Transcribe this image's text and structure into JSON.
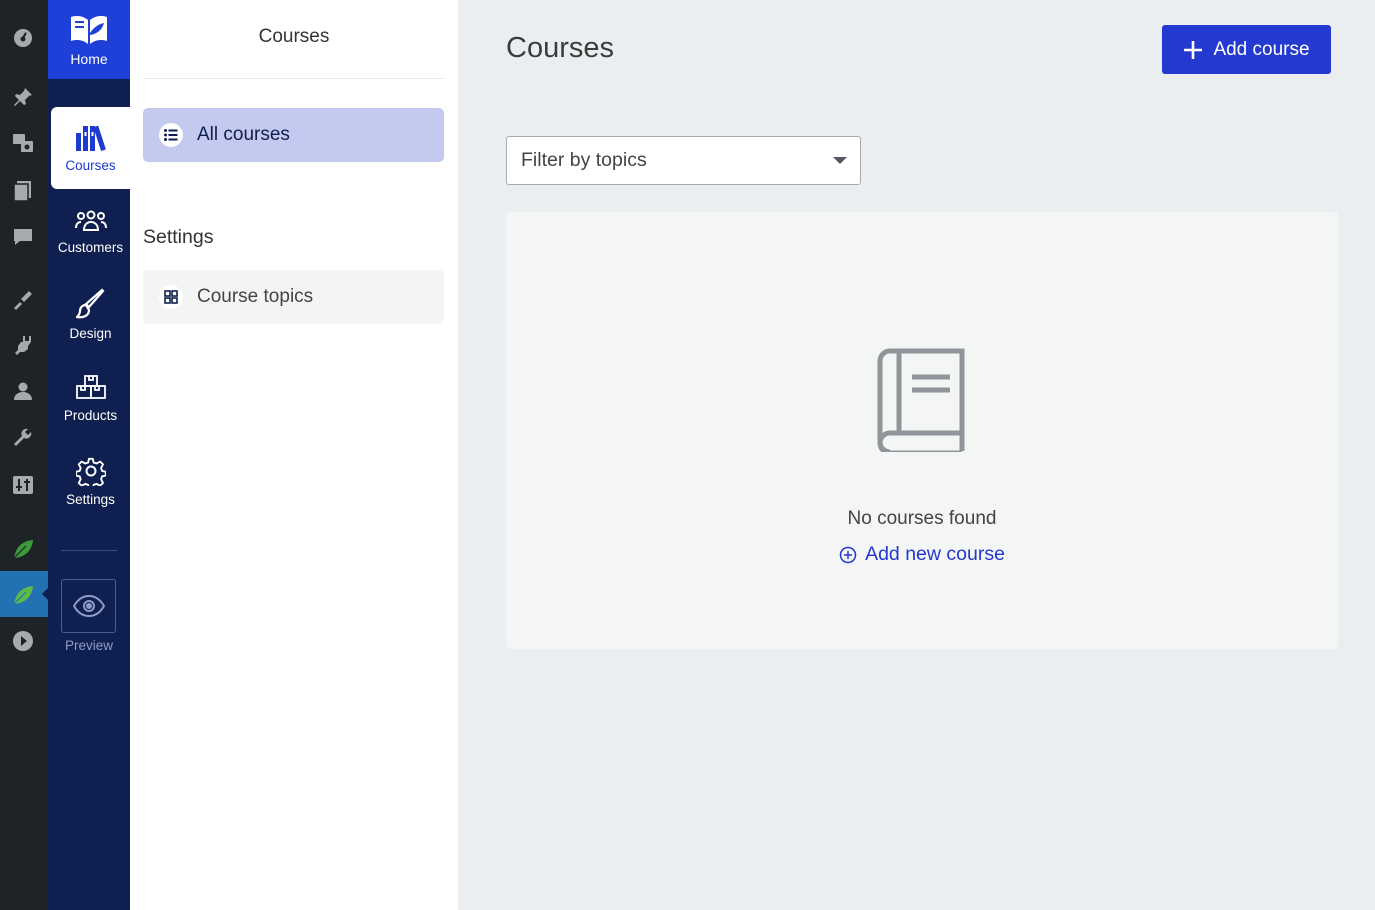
{
  "app_nav": {
    "home_label": "Home",
    "items": [
      {
        "label": "Courses"
      },
      {
        "label": "Customers"
      },
      {
        "label": "Design"
      },
      {
        "label": "Products"
      },
      {
        "label": "Settings"
      }
    ],
    "preview_label": "Preview"
  },
  "sub_nav": {
    "title": "Courses",
    "all_courses": "All courses",
    "settings_heading": "Settings",
    "course_topics": "Course topics"
  },
  "main": {
    "title": "Courses",
    "add_button": "Add course",
    "filter_placeholder": "Filter by topics",
    "empty_message": "No courses found",
    "add_new_link": "Add new course"
  },
  "colors": {
    "brand_blue": "#2439cf",
    "nav_dark": "#0f1f4f",
    "active_sub": "#c3c9ef"
  }
}
